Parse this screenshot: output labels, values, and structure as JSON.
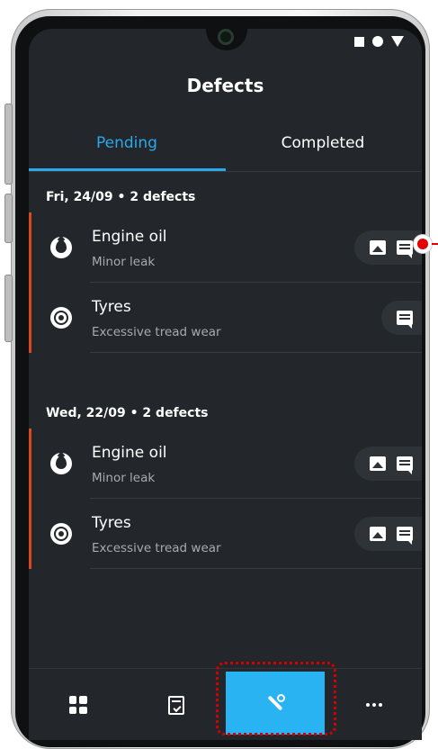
{
  "app": {
    "title": "Defects"
  },
  "tabs": [
    {
      "label": "Pending",
      "active": true
    },
    {
      "label": "Completed",
      "active": false
    }
  ],
  "groups": [
    {
      "header": "Fri, 24/09  •  2 defects",
      "items": [
        {
          "name": "Engine oil",
          "detail": "Minor leak",
          "icon": "oil-drop-icon",
          "actions": [
            "image-icon",
            "comment-icon"
          ]
        },
        {
          "name": "Tyres",
          "detail": "Excessive tread wear",
          "icon": "tyre-icon",
          "actions": [
            "comment-icon"
          ]
        }
      ]
    },
    {
      "header": "Wed, 22/09  •  2 defects",
      "items": [
        {
          "name": "Engine oil",
          "detail": "Minor leak",
          "icon": "oil-drop-icon",
          "actions": [
            "image-icon",
            "comment-icon"
          ]
        },
        {
          "name": "Tyres",
          "detail": "Excessive tread wear",
          "icon": "tyre-icon",
          "actions": [
            "image-icon",
            "comment-icon"
          ]
        }
      ]
    }
  ],
  "bottom_nav": [
    {
      "icon": "dashboard-grid-icon",
      "active": false
    },
    {
      "icon": "checklist-icon",
      "active": false
    },
    {
      "icon": "wrench-icon",
      "active": true
    },
    {
      "icon": "more-dots-icon",
      "active": false
    }
  ],
  "colors": {
    "background": "#23272b",
    "accent": "#2aa8ea",
    "defect_accent": "#d64a1f",
    "active_nav": "#2ab3f2",
    "highlight": "#d40000"
  }
}
